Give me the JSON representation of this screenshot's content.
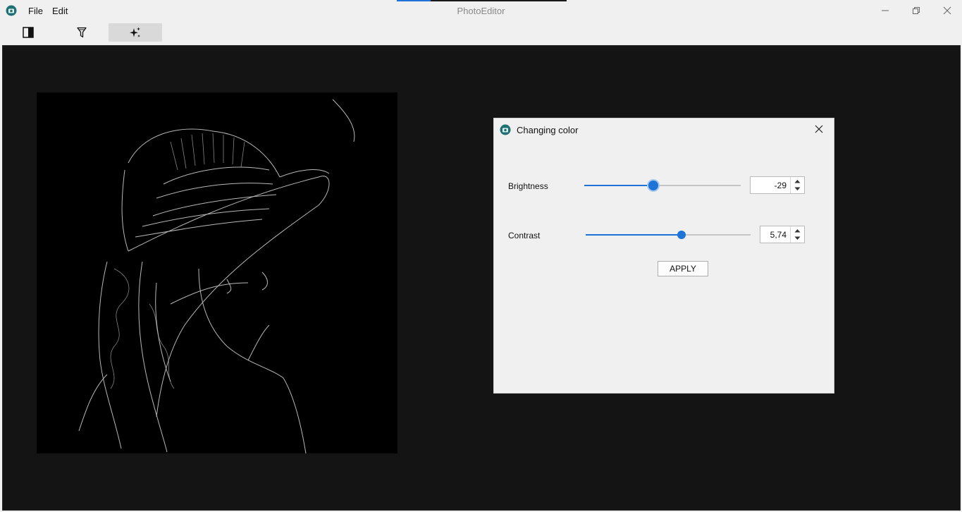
{
  "window": {
    "title": "PhotoEditor",
    "progress": 0.2
  },
  "menu": {
    "file_label": "File",
    "edit_label": "Edit"
  },
  "toolbar": {
    "tools": [
      "split-view-icon",
      "filter-icon",
      "sparkle-effects-icon"
    ],
    "active_tool": "sparkle-effects-icon"
  },
  "dialog": {
    "title": "Changing color",
    "brightness": {
      "label": "Brightness",
      "value": "-29",
      "level": 0.44
    },
    "contrast": {
      "label": "Contrast",
      "value": "5,74",
      "level": 0.58
    },
    "apply_label": "APPLY"
  },
  "colors": {
    "accent": "#1e73d8",
    "canvas": "#141414",
    "dialog_bg": "#f0f0f0"
  }
}
